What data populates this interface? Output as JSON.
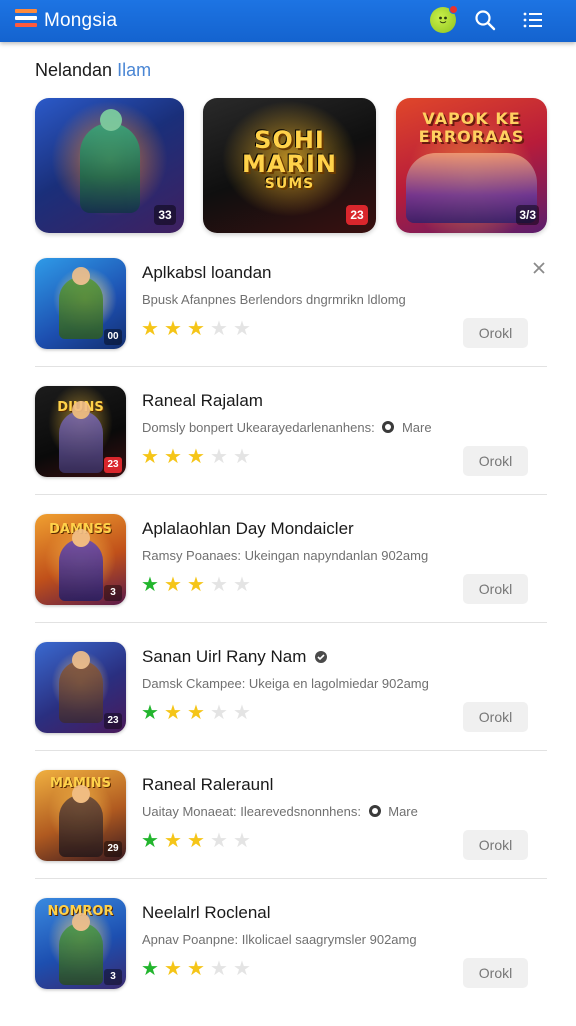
{
  "header": {
    "app_title": "Mongsia",
    "brand_color": "#1d74e3",
    "icons": [
      "logo-icon",
      "avatar-icon",
      "search-icon",
      "menu-icon"
    ]
  },
  "section": {
    "title_main": "Nelandan",
    "title_accent": "Ilam"
  },
  "featured": [
    {
      "badge": "33"
    },
    {
      "text_line1": "SOHI",
      "text_line2": "MARIN",
      "text_line3": "SUMS",
      "badge": "23"
    },
    {
      "text_line1": "VAPOK KE",
      "text_line2": "ERRORAAS",
      "badge": "3/3"
    }
  ],
  "items": [
    {
      "title": "Aplkabsl loandan",
      "description": "Bpusk Afanpnes Berlendors dngrmrikn ldlomg",
      "stars": [
        1,
        1,
        1,
        0,
        0
      ],
      "star_colors": [
        "yellow",
        "yellow",
        "yellow"
      ],
      "button": "Orokl",
      "thumb_badge": "00"
    },
    {
      "title": "Raneal Rajalam",
      "description": "Domsly bonpert Ukearayedarlenanhens:",
      "description_suffix": "Mare",
      "stars": [
        1,
        1,
        1,
        0,
        0
      ],
      "star_colors": [
        "yellow",
        "yellow",
        "yellow"
      ],
      "button": "Orokl",
      "thumb_word": "DIUNS",
      "thumb_badge": "23"
    },
    {
      "title": "Aplalaohlan Day Mondaicler",
      "description": "Ramsy Poanaes: Ukeingan napyndanlan 902amg",
      "stars": [
        1,
        1,
        1,
        0,
        0
      ],
      "star_colors": [
        "green",
        "yellow",
        "yellow"
      ],
      "button": "Orokl",
      "thumb_word": "DAMNSS",
      "thumb_badge": "3"
    },
    {
      "title": "Sanan Uirl Rany Nam",
      "description": "Damsk Ckampee: Ukeiga en lagolmiedar 902amg",
      "stars": [
        1,
        1,
        1,
        0,
        0
      ],
      "star_colors": [
        "green",
        "yellow",
        "yellow"
      ],
      "button": "Orokl",
      "thumb_badge": "23"
    },
    {
      "title": "Raneal Raleraunl",
      "description": "Uaitay Monaeat: Ilearevedsnonnhens:",
      "description_suffix": "Mare",
      "stars": [
        1,
        1,
        1,
        0,
        0
      ],
      "star_colors": [
        "green",
        "yellow",
        "yellow"
      ],
      "button": "Orokl",
      "thumb_word": "MAMINS",
      "thumb_badge": "29"
    },
    {
      "title": "Neelalrl Roclenal",
      "description": "Apnav Poanpne: Ilkolicael saagrymsler 902amg",
      "stars": [
        1,
        1,
        1,
        0,
        0
      ],
      "star_colors": [
        "green",
        "yellow",
        "yellow"
      ],
      "button": "Orokl",
      "thumb_word": "NOMROR",
      "thumb_badge": "3"
    }
  ]
}
